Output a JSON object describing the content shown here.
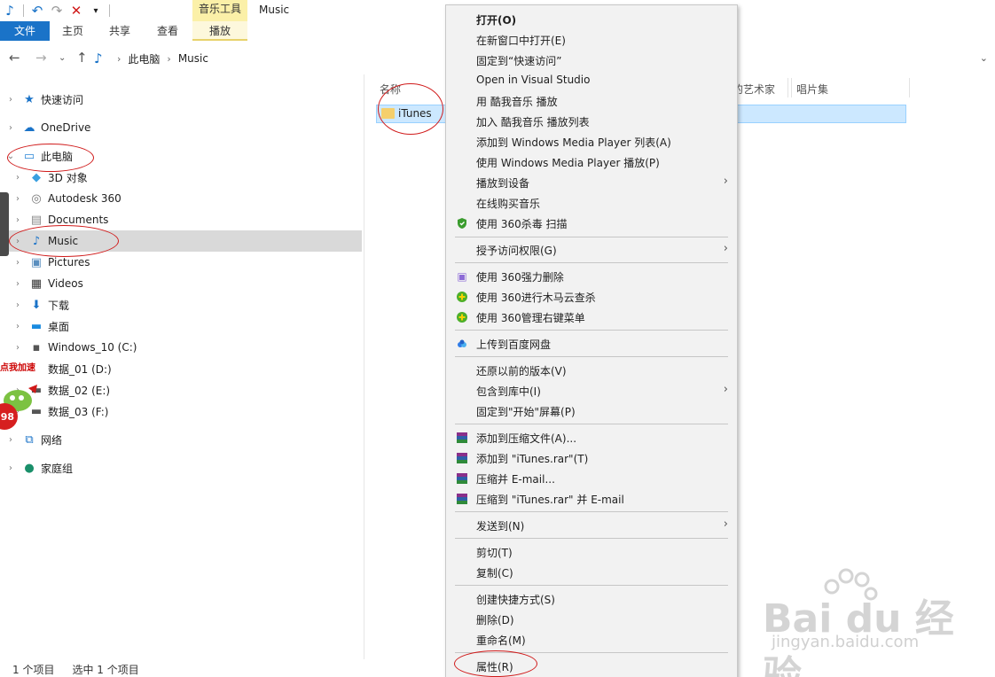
{
  "titlebar": {
    "context_tab_group": "音乐工具",
    "window_title": "Music",
    "quick_access": [
      "music-icon",
      "undo-icon",
      "redo-icon",
      "delete-icon",
      "customize-dropdown-icon"
    ]
  },
  "ribbon": {
    "file": "文件",
    "home": "主页",
    "share": "共享",
    "view": "查看",
    "play": "播放"
  },
  "address": {
    "crumbs": [
      "此电脑",
      "Music"
    ]
  },
  "navpane": {
    "items": [
      {
        "label": "快速访问",
        "icon": "star-icon"
      },
      {
        "label": "OneDrive",
        "icon": "cloud-icon"
      },
      {
        "label": "此电脑",
        "icon": "computer-icon"
      },
      {
        "label": "3D 对象",
        "icon": "cube-icon"
      },
      {
        "label": "Autodesk 360",
        "icon": "autodesk-icon"
      },
      {
        "label": "Documents",
        "icon": "document-icon"
      },
      {
        "label": "Music",
        "icon": "music-note-icon"
      },
      {
        "label": "Pictures",
        "icon": "pictures-icon"
      },
      {
        "label": "Videos",
        "icon": "film-icon"
      },
      {
        "label": "下载",
        "icon": "download-arrow-icon"
      },
      {
        "label": "桌面",
        "icon": "desktop-icon"
      },
      {
        "label": "Windows_10 (C:)",
        "icon": "windows-drive-icon"
      },
      {
        "label": "数据_01 (D:)",
        "icon": "drive-icon"
      },
      {
        "label": "数据_02 (E:)",
        "icon": "drive-icon"
      },
      {
        "label": "数据_03 (F:)",
        "icon": "drive-icon"
      },
      {
        "label": "网络",
        "icon": "network-icon"
      },
      {
        "label": "家庭组",
        "icon": "homegroup-icon"
      }
    ]
  },
  "columns": {
    "name": "名称",
    "artist": "参与创作的艺术家",
    "album": "唱片集"
  },
  "files": [
    {
      "name": "iTunes",
      "icon": "folder-icon"
    }
  ],
  "status": {
    "count": "1 个项目",
    "selected": "选中 1 个项目"
  },
  "context_menu": {
    "items": [
      {
        "label": "打开(O)"
      },
      {
        "label": "在新窗口中打开(E)"
      },
      {
        "label": "固定到“快速访问”"
      },
      {
        "label": "Open in Visual Studio"
      },
      {
        "label": "用 酷我音乐 播放"
      },
      {
        "label": "加入 酷我音乐 播放列表"
      },
      {
        "label": "添加到 Windows Media Player 列表(A)"
      },
      {
        "label": "使用 Windows Media Player 播放(P)"
      },
      {
        "label": "播放到设备"
      },
      {
        "label": "在线购买音乐"
      },
      {
        "label": "使用 360杀毒 扫描",
        "icon": "360-antivirus-icon"
      },
      {
        "label": "授予访问权限(G)"
      },
      {
        "label": "使用 360强力删除",
        "icon": "360-shred-icon"
      },
      {
        "label": "使用 360进行木马云查杀",
        "icon": "360-trojan-scan-icon"
      },
      {
        "label": "使用 360管理右键菜单",
        "icon": "360-menu-manager-icon"
      },
      {
        "label": "上传到百度网盘",
        "icon": "baidu-netdisk-icon"
      },
      {
        "label": "还原以前的版本(V)"
      },
      {
        "label": "包含到库中(I)"
      },
      {
        "label": "固定到\"开始\"屏幕(P)"
      },
      {
        "label": "添加到压缩文件(A)...",
        "icon": "winrar-icon"
      },
      {
        "label": "添加到 \"iTunes.rar\"(T)",
        "icon": "winrar-icon"
      },
      {
        "label": "压缩并 E-mail...",
        "icon": "winrar-icon"
      },
      {
        "label": "压缩到 \"iTunes.rar\" 并 E-mail",
        "icon": "winrar-icon"
      },
      {
        "label": "发送到(N)"
      },
      {
        "label": "剪切(T)"
      },
      {
        "label": "复制(C)"
      },
      {
        "label": "创建快捷方式(S)"
      },
      {
        "label": "删除(D)"
      },
      {
        "label": "重命名(M)"
      },
      {
        "label": "属性(R)"
      }
    ]
  },
  "widgets": {
    "speedup": "点我加速",
    "badge": "98"
  },
  "watermark": {
    "text": "Bai du 经验",
    "sub": "jingyan.baidu.com"
  },
  "colors": {
    "accent": "#1a73c8",
    "selection": "#cce8ff",
    "annotation": "#d01a1a",
    "context_tab": "#fbf0a8"
  }
}
